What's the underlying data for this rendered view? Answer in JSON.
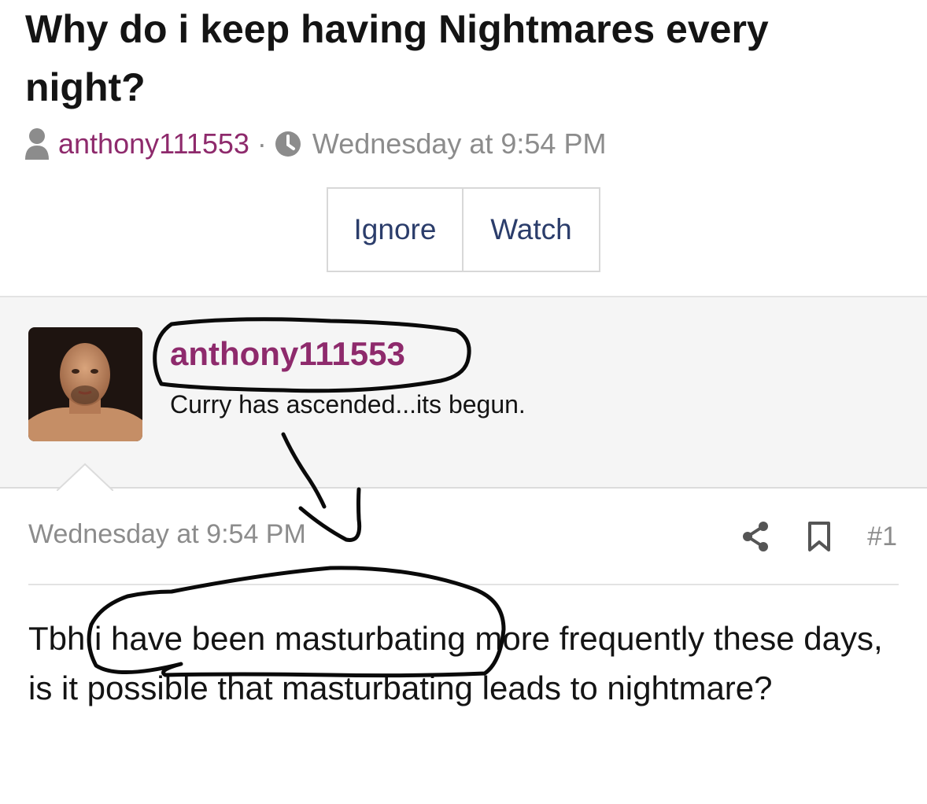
{
  "thread": {
    "title": "Why do i keep having Nightmares every night?",
    "author": "anthony111553",
    "separator": "·",
    "date": "Wednesday at 9:54 PM"
  },
  "buttons": {
    "ignore_label": "Ignore",
    "watch_label": "Watch"
  },
  "post": {
    "author": "anthony111553",
    "user_title": "Curry has ascended...its begun.",
    "date": "Wednesday at 9:54 PM",
    "number": "#1",
    "body": "Tbh i have been masturbating more frequently these days, is it possible that masturbating leads to nightmare?"
  },
  "icons": {
    "user": "user-icon",
    "clock": "clock-icon",
    "share": "share-icon",
    "bookmark": "bookmark-icon"
  },
  "colors": {
    "author_link": "#8e2a6c",
    "button_text": "#2b3d6b",
    "muted_text": "#8c8c8c"
  }
}
